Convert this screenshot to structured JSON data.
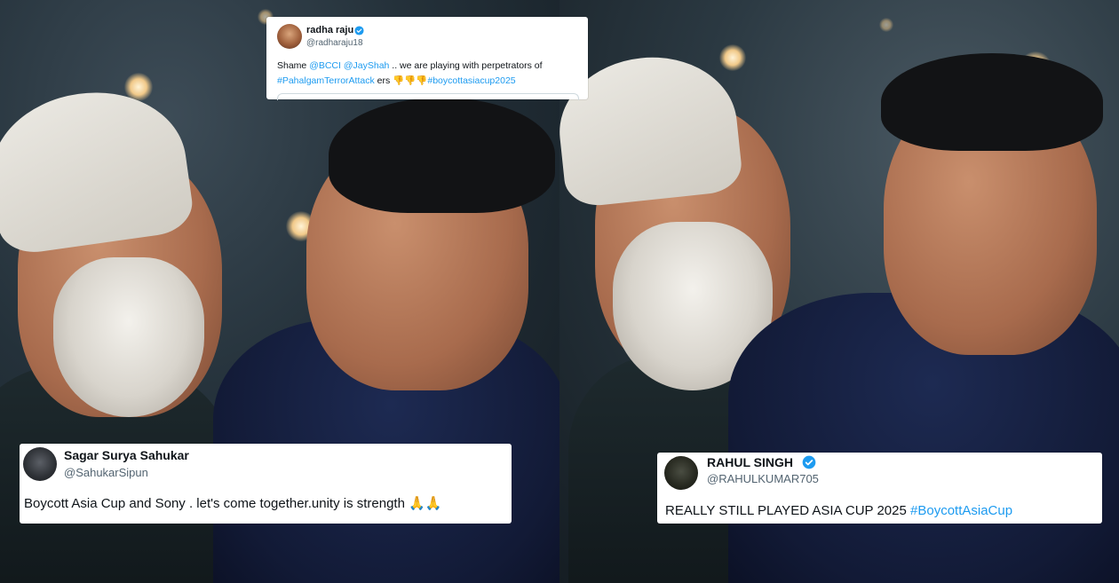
{
  "tweets": {
    "top": {
      "name": "radha raju",
      "handle": "@radharaju18",
      "body_line1": {
        "text": "Shame ",
        "mention1": "@BCCI",
        "mention2": "@JaySha​h",
        "rest": " .. we are playing with perpetrators of"
      },
      "body_line2": {
        "hashtag1": "#PahalgamTerrorAttack",
        "mid": " ers ",
        "emoji": "👎👎👎",
        "hashtag2": "#boycottasiacup2025"
      }
    },
    "left": {
      "name": "Sagar Surya Sahukar",
      "handle": "@SahukarSipun",
      "body": "Boycott Asia Cup and Sony . let's come together.unity is strength ",
      "emoji": "🙏🙏"
    },
    "right": {
      "name": "RAHUL SINGH",
      "handle": "@RAHULKUMAR705",
      "body": "REALLY STILL PLAYED ASIA CUP 2025 ",
      "hashtag": "#BoycottAsiaCup"
    }
  },
  "colors": {
    "link": "#1d9bf0",
    "verified": "#1d9bf0",
    "handle": "#536471"
  },
  "icons": {
    "verified": "verified-badge-icon"
  }
}
